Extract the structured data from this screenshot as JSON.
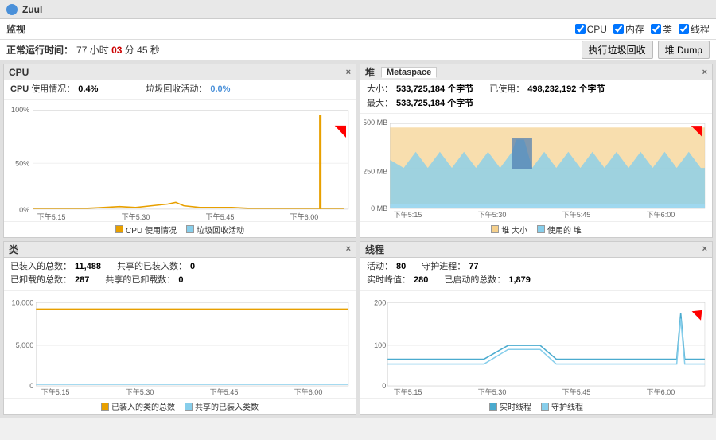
{
  "titleBar": {
    "appIcon": "●",
    "appName": "Zuul"
  },
  "header": {
    "label": "监视",
    "checkboxes": [
      {
        "id": "cb-cpu",
        "label": "CPU",
        "checked": true
      },
      {
        "id": "cb-mem",
        "label": "内存",
        "checked": true
      },
      {
        "id": "cb-class",
        "label": "类",
        "checked": true
      },
      {
        "id": "cb-thread",
        "label": "线程",
        "checked": true
      }
    ]
  },
  "uptime": {
    "prefix": "正常运行时间：",
    "hours": "77",
    "hoursLabel": "小时",
    "minutes": "03",
    "minutesLabel": "分",
    "seconds": "45",
    "secondsLabel": "秒"
  },
  "actions": {
    "gcButton": "执行垃圾回收",
    "dumpButton": "堆 Dump"
  },
  "panels": {
    "cpu": {
      "title": "CPU",
      "tab": "CPU",
      "cpuUsage": "0.4%",
      "gcActivity": "0.0%",
      "cpuLabel": "CPU 使用情况：",
      "gcLabel": "垃圾回收活动：",
      "legends": [
        {
          "color": "#e8a000",
          "label": "CPU 使用情况"
        },
        {
          "color": "#87ceeb",
          "label": "垃圾回收活动"
        }
      ],
      "xLabels": [
        "下午5:15",
        "下午5:30",
        "下午5:45",
        "下午6:00"
      ]
    },
    "heap": {
      "title": "堆",
      "tab": "Metaspace",
      "sizeLabel": "大小：",
      "sizeValue": "533,725,184 个字节",
      "maxLabel": "最大：",
      "maxValue": "533,725,184 个字节",
      "usedLabel": "已使用：",
      "usedValue": "498,232,192 个字节",
      "legends": [
        {
          "color": "#f5d08c",
          "label": "堆 大小"
        },
        {
          "color": "#87ceeb",
          "label": "使用的 堆"
        }
      ],
      "xLabels": [
        "下午5:15",
        "下午5:30",
        "下午5:45",
        "下午6:00"
      ]
    },
    "classes": {
      "title": "类",
      "loadedTotal": "11,488",
      "unloadedTotal": "287",
      "sharedLoaded": "0",
      "sharedUnloaded": "0",
      "loadedTotalLabel": "已装入的总数：",
      "unloadedTotalLabel": "已卸载的总数：",
      "sharedLoadedLabel": "共享的已装入数：",
      "sharedUnloadedLabel": "共享的已卸载数：",
      "legends": [
        {
          "color": "#e8a000",
          "label": "已装入的类的总数"
        },
        {
          "color": "#87ceeb",
          "label": "共享的已装入类数"
        }
      ],
      "xLabels": [
        "下午5:15",
        "下午5:30",
        "下午5:45",
        "下午6:00"
      ]
    },
    "threads": {
      "title": "线程",
      "active": "80",
      "peakLive": "280",
      "daemon": "77",
      "totalStarted": "1,879",
      "activeLabel": "活动：",
      "peakLabel": "实时峰值：",
      "daemonLabel": "守护进程：",
      "totalLabel": "已启动的总数：",
      "legends": [
        {
          "color": "#4aabcf",
          "label": "实时线程"
        },
        {
          "color": "#87ceeb",
          "label": "守护线程"
        }
      ],
      "xLabels": [
        "下午5:15",
        "下午5:30",
        "下午5:45",
        "下午6:00"
      ]
    }
  }
}
